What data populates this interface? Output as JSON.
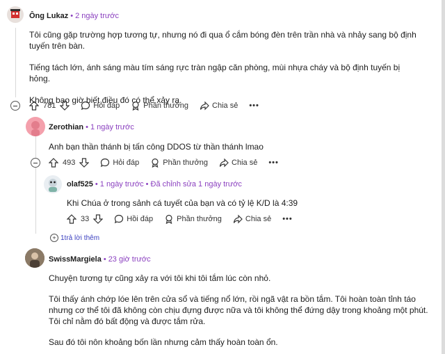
{
  "comments": [
    {
      "user": "Ông Lukaz",
      "time": "2 ngày trước",
      "paragraphs": [
        "Tôi cũng gặp trường hợp tương tự, nhưng nó đi qua ổ cắm bóng đèn trên trần nhà và nhảy sang bộ định tuyến trên bàn.",
        "Tiếng tách lớn, ánh sáng màu tím sáng rực tràn ngập căn phòng, mùi nhựa cháy và bộ định tuyến bị hỏng.",
        "Không bao giờ biết điều đó có thể xảy ra."
      ],
      "votes": "781",
      "reply_label": "Hỏi đáp",
      "award_label": "Phần thưởng",
      "share_label": "Chia sẻ"
    },
    {
      "user": "Zerothian",
      "time": "1 ngày trước",
      "paragraphs": [
        "Anh bạn thần thánh bị tấn công DDOS từ thần thánh lmao"
      ],
      "votes": "493",
      "reply_label": "Hỏi đáp",
      "award_label": "Phần thưởng",
      "share_label": "Chia sẻ"
    },
    {
      "user": "olaf525",
      "time": "1 ngày trước",
      "edited": "Đã chỉnh sửa 1 ngày trước",
      "paragraphs": [
        "Khi Chúa ở trong sảnh cá tuyết của bạn và có tỷ lệ K/D là 4:39"
      ],
      "votes": "33",
      "reply_label": "Hồi đáp",
      "award_label": "Phần thưởng",
      "share_label": "Chia sẻ"
    },
    {
      "user": "SwissMargiela",
      "time": "23 giờ trước",
      "paragraphs": [
        "Chuyện tương tự cũng xảy ra với tôi khi tôi tắm lúc còn nhỏ.",
        "Tôi thấy ánh chớp lóe lên trên cửa sổ và tiếng nổ lớn, rồi ngã vật ra bồn tắm. Tôi hoàn toàn tỉnh táo nhưng cơ thể tôi đã không còn chịu đựng được nữa và tôi không thể đứng dậy trong khoảng một phút. Tôi chỉ nằm đó bất động và được tắm rửa.",
        "Sau đó tôi nôn khoảng bốn lần nhưng cảm thấy hoàn toàn ổn."
      ]
    }
  ],
  "more_replies": "1trả lời thêm",
  "more_glyph": "•••",
  "colors": {
    "time": "#8a3fbf",
    "link": "#3a3fbf",
    "thread": "#d8d8d8"
  },
  "icons": [
    "upvote-icon",
    "downvote-icon",
    "comment-bubble-icon",
    "award-icon",
    "share-icon",
    "collapse-icon",
    "expand-icon"
  ]
}
